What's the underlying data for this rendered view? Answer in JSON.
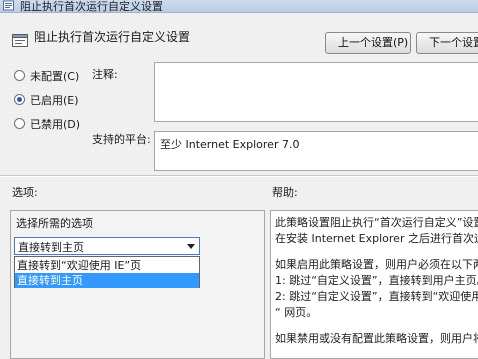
{
  "window": {
    "title": "阻止执行首次运行自定义设置"
  },
  "header": {
    "title": "阻止执行首次运行自定义设置"
  },
  "nav": {
    "prev_label": "上一个设置(P)",
    "next_label": "下一个设置"
  },
  "state": {
    "options": [
      {
        "label": "未配置(C)",
        "selected": false
      },
      {
        "label": "已启用(E)",
        "selected": true
      },
      {
        "label": "已禁用(D)",
        "selected": false
      }
    ]
  },
  "comment": {
    "label": "注释:",
    "value": ""
  },
  "platform": {
    "label": "支持的平台:",
    "value": "至少 Internet Explorer 7.0"
  },
  "sections": {
    "options_heading": "选项:",
    "help_heading": "帮助:"
  },
  "options_pane": {
    "choose_label": "选择所需的选项",
    "dropdown_value": "直接转到主页",
    "dropdown_options": [
      "直接转到“欢迎使用 IE”页",
      "直接转到主页"
    ]
  },
  "help": {
    "lines": [
      "此策略设置阻止执行“首次运行自定义”设置",
      "在安装 Internet Explorer 之后进行首次运行",
      "",
      "如果启用此策略设置，则用户必须在以下两种",
      "1: 跳过“自定义设置”，直接转到用户主页。",
      "2: 跳过“自定义设置”，直接转到“欢迎使用",
      "“ 网页。",
      "",
      "如果禁用或没有配置此策略设置，则用户将进"
    ]
  },
  "colors": {
    "selection": "#3399ff",
    "titlebar": "#c4d5ea"
  }
}
